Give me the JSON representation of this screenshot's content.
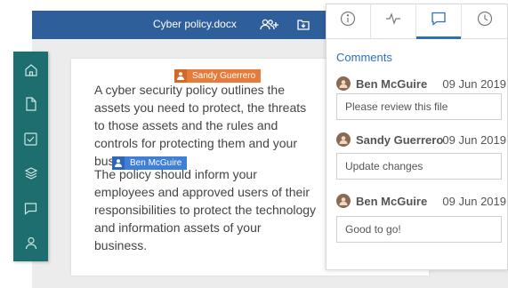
{
  "document": {
    "title": "Cyber policy.docx",
    "paragraphs": [
      "A cyber security policy outlines the assets you need to protect, the threats to those assets and the rules and controls for protecting them and your business.",
      "The policy should inform your employees and approved users of their responsibilities to protect the technology and information assets of your business."
    ],
    "cursors": [
      {
        "name": "Sandy Guerrero",
        "color": "#e67c3b"
      },
      {
        "name": "Ben McGuire",
        "color": "#3f7fd6"
      }
    ]
  },
  "toolbar": {
    "icons": [
      "add-user-icon",
      "import-icon"
    ]
  },
  "sidebar": {
    "items": [
      "home-icon",
      "file-icon",
      "checkbox-icon",
      "layers-icon",
      "comment-icon",
      "user-icon"
    ],
    "color": "#1d6e6e"
  },
  "panel": {
    "tabs": [
      "info-icon",
      "activity-icon",
      "comments-icon",
      "clock-icon"
    ],
    "active_tab": "comments-icon",
    "title": "Comments",
    "comments": [
      {
        "author": "Ben McGuire",
        "date": "09 Jun 2019",
        "text": "Please review this file"
      },
      {
        "author": "Sandy Guerrero",
        "date": "09 Jun 2019",
        "text": "Update changes"
      },
      {
        "author": "Ben McGuire",
        "date": "09 Jun 2019",
        "text": "Good to go!"
      }
    ]
  },
  "colors": {
    "topbar": "#2f5f9b",
    "accent": "#2e6fbd"
  }
}
